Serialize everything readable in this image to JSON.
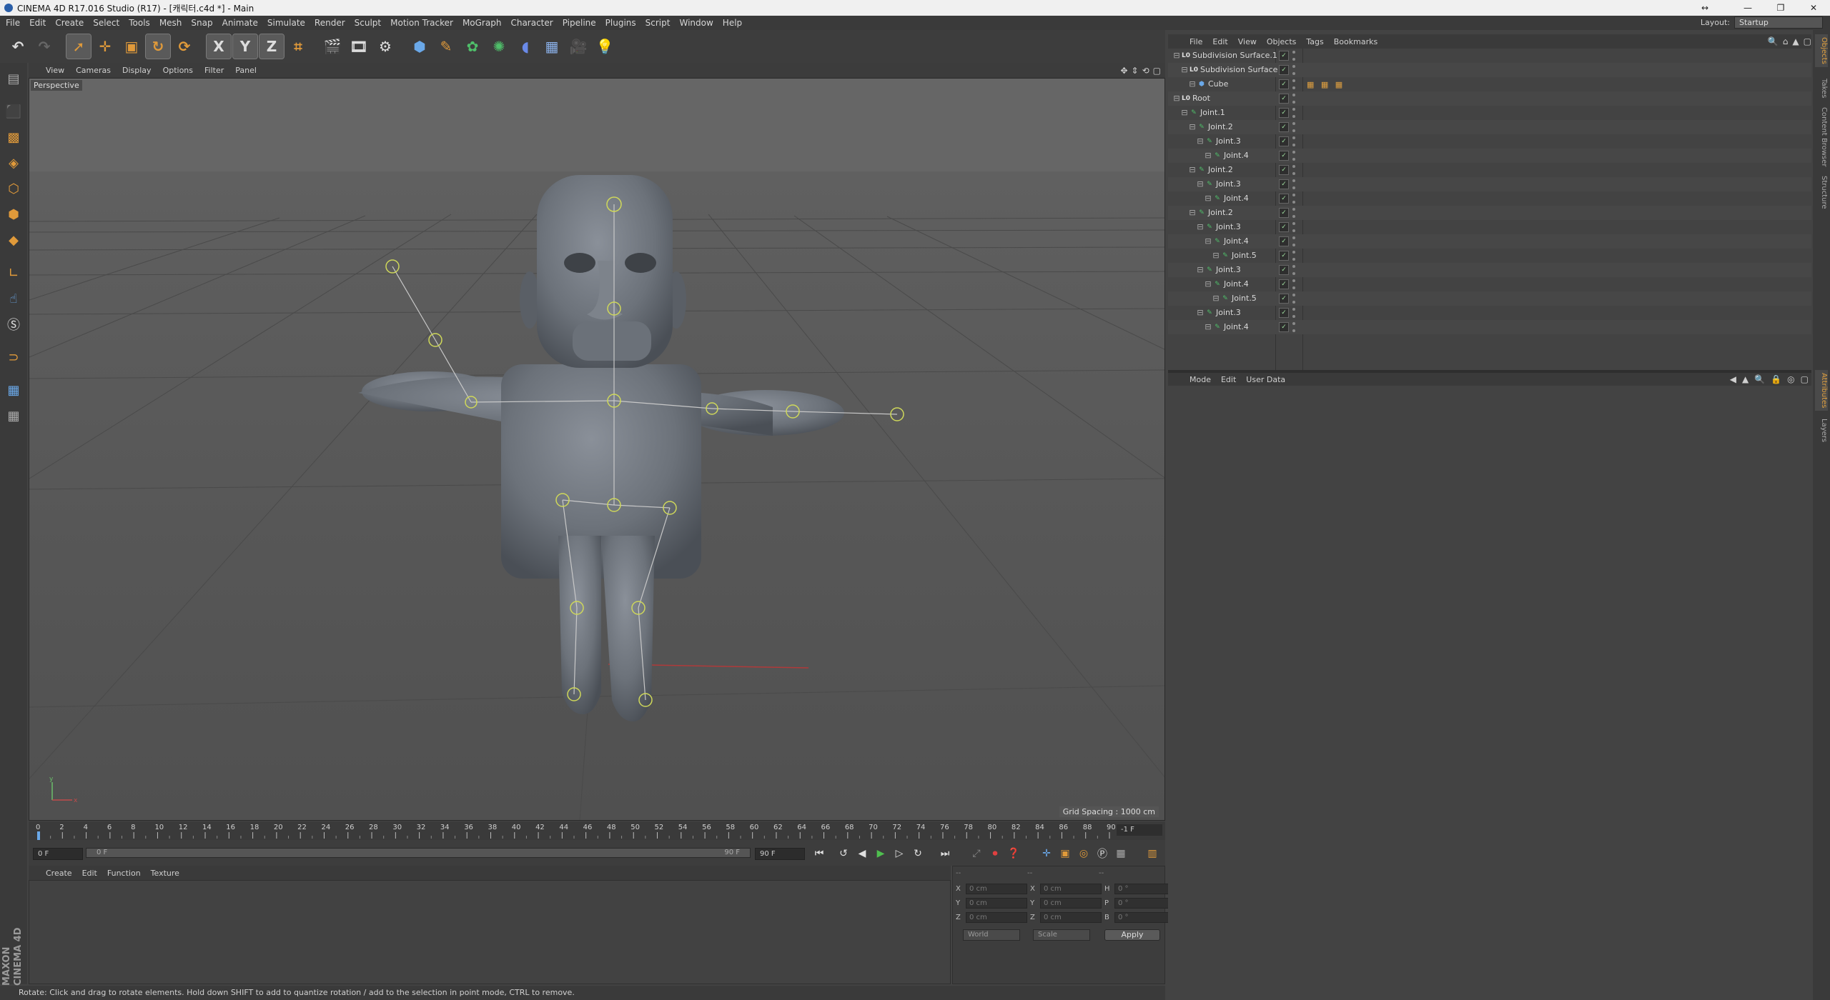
{
  "window": {
    "title": "CINEMA 4D R17.016 Studio (R17) - [캐릭터.c4d *] - Main",
    "extra_icon": "↔",
    "min": "—",
    "max": "❐",
    "close": "✕"
  },
  "menu": {
    "items": [
      "File",
      "Edit",
      "Create",
      "Select",
      "Tools",
      "Mesh",
      "Snap",
      "Animate",
      "Simulate",
      "Render",
      "Sculpt",
      "Motion Tracker",
      "MoGraph",
      "Character",
      "Pipeline",
      "Plugins",
      "Script",
      "Window",
      "Help"
    ],
    "layout_label": "Layout:",
    "layout_value": "Startup"
  },
  "toolbar": {
    "undo": "↶",
    "redo": "↷",
    "axis_x": "X",
    "axis_y": "Y",
    "axis_z": "Z"
  },
  "viewport": {
    "menus": [
      "View",
      "Cameras",
      "Display",
      "Options",
      "Filter",
      "Panel"
    ],
    "camera_label": "Perspective",
    "grid_spacing": "Grid Spacing : 1000 cm",
    "axis_y": "y",
    "axis_x": "x"
  },
  "timeline": {
    "ticks": [
      "0",
      "2",
      "4",
      "6",
      "8",
      "10",
      "12",
      "14",
      "16",
      "18",
      "20",
      "22",
      "24",
      "26",
      "28",
      "30",
      "32",
      "34",
      "36",
      "38",
      "40",
      "42",
      "44",
      "46",
      "48",
      "50",
      "52",
      "54",
      "56",
      "58",
      "60",
      "62",
      "64",
      "66",
      "68",
      "70",
      "72",
      "74",
      "76",
      "78",
      "80",
      "82",
      "84",
      "86",
      "88",
      "90"
    ],
    "frame_readout": "-1 F",
    "current_frame": "0 F",
    "range_start": "0 F",
    "range_end": "90 F",
    "end_frame": "90 F"
  },
  "material_manager": {
    "menus": [
      "Create",
      "Edit",
      "Function",
      "Texture"
    ]
  },
  "coordinates": {
    "header_left": "--",
    "header_mid": "--",
    "header_right": "--",
    "rows": [
      {
        "a": "X",
        "av": "0 cm",
        "b": "X",
        "bv": "0 cm",
        "c": "H",
        "cv": "0 °"
      },
      {
        "a": "Y",
        "av": "0 cm",
        "b": "Y",
        "bv": "0 cm",
        "c": "P",
        "cv": "0 °"
      },
      {
        "a": "Z",
        "av": "0 cm",
        "b": "Z",
        "bv": "0 cm",
        "c": "B",
        "cv": "0 °"
      }
    ],
    "mode": "World",
    "type": "Scale",
    "apply": "Apply"
  },
  "status": "Rotate: Click and drag to rotate elements. Hold down SHIFT to add to quantize rotation / add to the selection in point mode, CTRL to remove.",
  "object_manager": {
    "menus": [
      "File",
      "Edit",
      "View",
      "Objects",
      "Tags",
      "Bookmarks"
    ],
    "tags_cube": "▦ ▦ ▦",
    "objects": [
      {
        "name": "Subdivision Surface.1",
        "kind": "subd"
      },
      {
        "name": "Subdivision Surface",
        "kind": "subd"
      },
      {
        "name": "Cube",
        "kind": "cube"
      },
      {
        "name": "Root",
        "kind": "null"
      },
      {
        "name": "Joint.1",
        "kind": "joint"
      },
      {
        "name": "Joint.2",
        "kind": "joint"
      },
      {
        "name": "Joint.3",
        "kind": "joint"
      },
      {
        "name": "Joint.4",
        "kind": "joint"
      },
      {
        "name": "Joint.2",
        "kind": "joint"
      },
      {
        "name": "Joint.3",
        "kind": "joint"
      },
      {
        "name": "Joint.4",
        "kind": "joint"
      },
      {
        "name": "Joint.2",
        "kind": "joint"
      },
      {
        "name": "Joint.3",
        "kind": "joint"
      },
      {
        "name": "Joint.4",
        "kind": "joint"
      },
      {
        "name": "Joint.5",
        "kind": "joint"
      },
      {
        "name": "Joint.3",
        "kind": "joint"
      },
      {
        "name": "Joint.4",
        "kind": "joint"
      },
      {
        "name": "Joint.5",
        "kind": "joint"
      },
      {
        "name": "Joint.3",
        "kind": "joint"
      },
      {
        "name": "Joint.4",
        "kind": "joint"
      }
    ]
  },
  "attribute_manager": {
    "menus": [
      "Mode",
      "Edit",
      "User Data"
    ]
  },
  "right_tabs": [
    "Objects",
    "Takes",
    "Content Browser",
    "Structure",
    "Attributes",
    "Layers"
  ],
  "branding": "MAXON CINEMA 4D",
  "colors": {
    "accent": "#e09a3a",
    "selection": "#6aa8e8",
    "joint": "#cfd85a"
  }
}
